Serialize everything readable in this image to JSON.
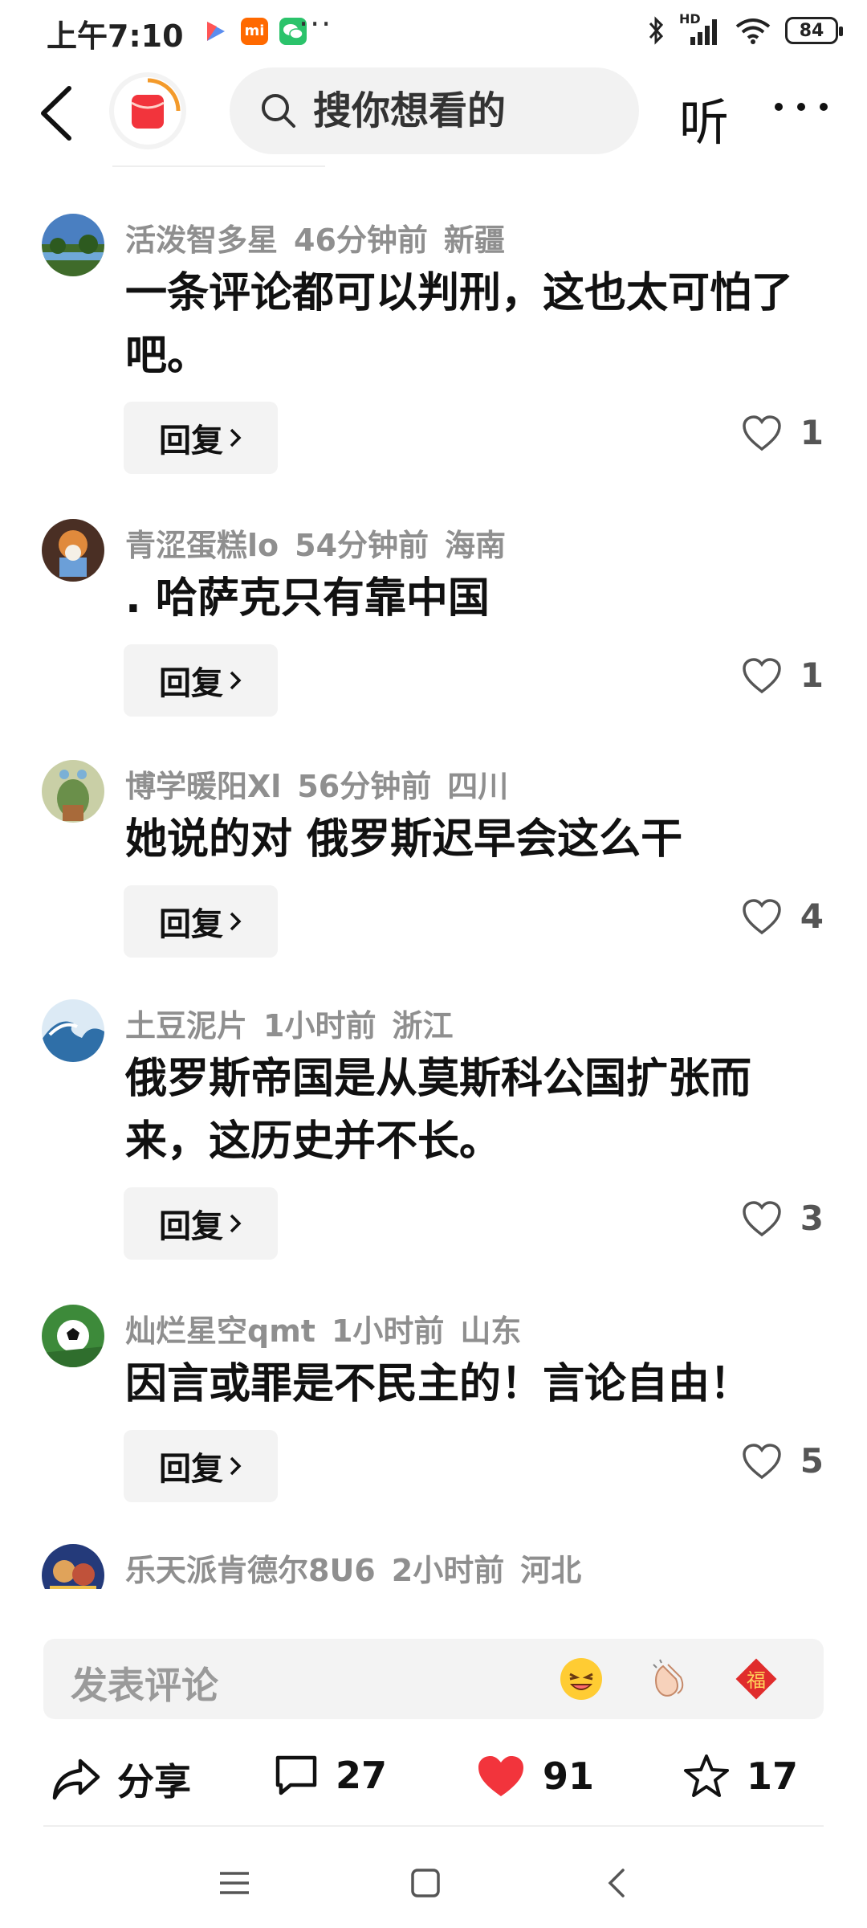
{
  "status_bar": {
    "time": "上午7:10",
    "battery": "84",
    "network_label": "HD"
  },
  "top_bar": {
    "search_placeholder": "搜你想看的",
    "listen_label": "听"
  },
  "comments": [
    {
      "name": "活泼智多星",
      "time": "46分钟前",
      "region": "新疆",
      "text": "一条评论都可以判刑，这也太可怕了吧。",
      "likes": "1"
    },
    {
      "name": "青涩蛋糕lo",
      "time": "54分钟前",
      "region": "海南",
      "text": ". 哈萨克只有靠中国",
      "likes": "1"
    },
    {
      "name": "博学暖阳Xl",
      "time": "56分钟前",
      "region": "四川",
      "text": "她说的对 俄罗斯迟早会这么干",
      "likes": "4"
    },
    {
      "name": "土豆泥片",
      "time": "1小时前",
      "region": "浙江",
      "text": "俄罗斯帝国是从莫斯科公国扩张而来，这历史并不长。",
      "likes": "3"
    },
    {
      "name": "灿烂星空qmt",
      "time": "1小时前",
      "region": "山东",
      "text": "因言或罪是不民主的！言论自由！",
      "likes": "5"
    },
    {
      "name": "乐天派肯德尔8U6",
      "time": "2小时前",
      "region": "河北",
      "text": "",
      "likes": ""
    }
  ],
  "reply_label": "回复",
  "comment_input": {
    "placeholder": "发表评论",
    "emojis": [
      "laughing-emoji-icon",
      "clapping-hands-icon",
      "fu-sticker-icon"
    ]
  },
  "actions": {
    "share_label": "分享",
    "comment_count": "27",
    "like_count": "91",
    "favorite_count": "17"
  },
  "colors": {
    "accent_red": "#f2343c",
    "meta_gray": "#8f8f8f",
    "surface_gray": "#f3f3f3"
  }
}
